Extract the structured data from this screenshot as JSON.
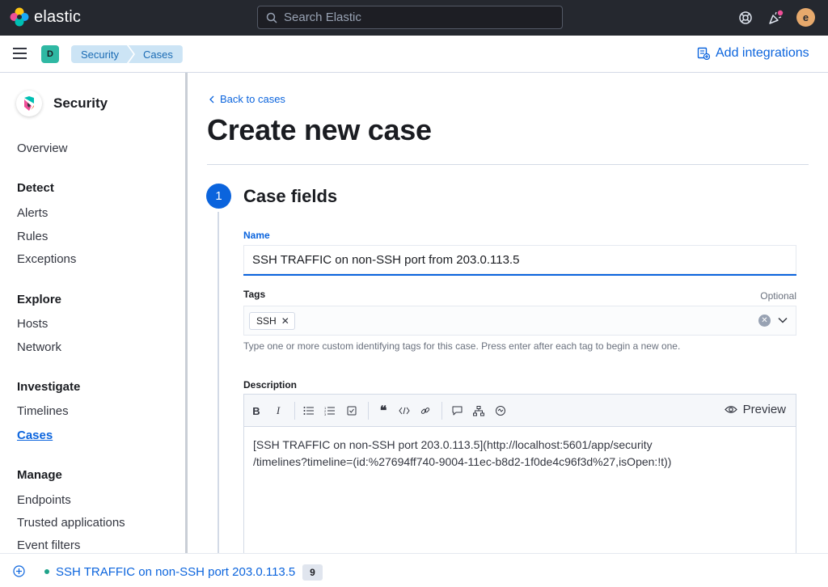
{
  "header": {
    "brand": "elastic",
    "search_placeholder": "Search Elastic",
    "avatar_initial": "e"
  },
  "subheader": {
    "space_initial": "D",
    "breadcrumbs": [
      "Security",
      "Cases"
    ],
    "add_integrations": "Add integrations"
  },
  "sidebar": {
    "title": "Security",
    "overview": "Overview",
    "groups": {
      "detect": "Detect",
      "explore": "Explore",
      "investigate": "Investigate",
      "manage": "Manage"
    },
    "items": {
      "alerts": "Alerts",
      "rules": "Rules",
      "exceptions": "Exceptions",
      "hosts": "Hosts",
      "network": "Network",
      "timelines": "Timelines",
      "cases": "Cases",
      "endpoints": "Endpoints",
      "trusted_applications": "Trusted applications",
      "event_filters": "Event filters"
    }
  },
  "main": {
    "back_link": "Back to cases",
    "title": "Create new case",
    "step_number": "1",
    "step_title": "Case fields",
    "name_label": "Name",
    "name_value": "SSH TRAFFIC on non-SSH port from 203.0.113.5",
    "tags_label": "Tags",
    "tags_optional": "Optional",
    "tags": [
      "SSH"
    ],
    "tags_help": "Type one or more custom identifying tags for this case. Press enter after each tag to begin a new one.",
    "description_label": "Description",
    "preview_label": "Preview",
    "description_line1": "[SSH TRAFFIC on non-SSH port 203.0.113.5](http://localhost:5601/app/security",
    "description_line2": "/timelines?timeline=(id:%27694ff740-9004-11ec-b8d2-1f0de4c96f3d%27,isOpen:!t))"
  },
  "bottom": {
    "timeline_title": "SSH TRAFFIC on non-SSH port 203.0.113.5",
    "count": "9"
  },
  "colors": {
    "accent": "#0b64dd",
    "header_bg": "#25282f",
    "breadcrumb_bg": "#cce4f5",
    "space_badge": "#2fb8a3"
  }
}
